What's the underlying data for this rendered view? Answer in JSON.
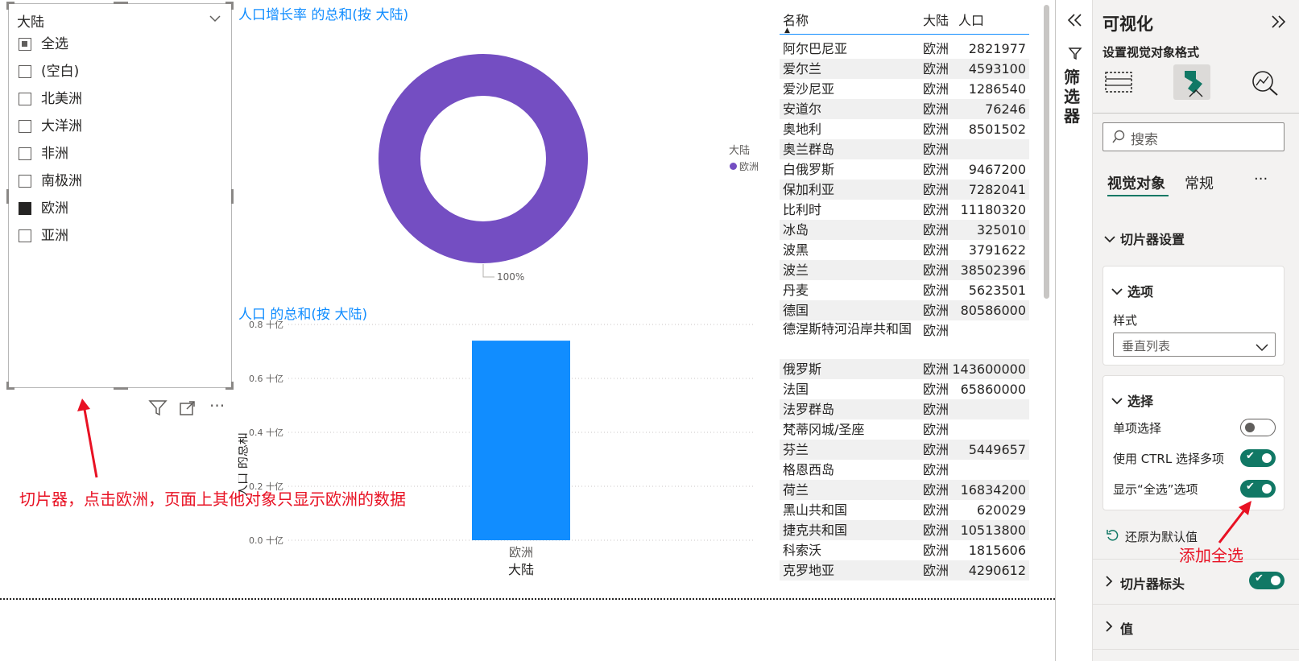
{
  "slicer": {
    "title": "大陆",
    "items": [
      {
        "label": "全选",
        "state": "partial"
      },
      {
        "label": "(空白)",
        "state": "unchecked"
      },
      {
        "label": "北美洲",
        "state": "unchecked"
      },
      {
        "label": "大洋洲",
        "state": "unchecked"
      },
      {
        "label": "非洲",
        "state": "unchecked"
      },
      {
        "label": "南极洲",
        "state": "unchecked"
      },
      {
        "label": "欧洲",
        "state": "checked"
      },
      {
        "label": "亚洲",
        "state": "unchecked"
      }
    ]
  },
  "donut": {
    "title": "人口增长率 的总和(按 大陆)",
    "color": "#744ec2",
    "slice_label": "100%",
    "legend_title": "大陆",
    "legend_items": [
      "欧洲"
    ]
  },
  "bar": {
    "title": "人口 的总和(按 大陆)"
  },
  "chart_data": [
    {
      "type": "pie",
      "title": "人口增长率 的总和(按 大陆)",
      "categories": [
        "欧洲"
      ],
      "values": [
        100
      ],
      "unit": "%",
      "legend_title": "大陆",
      "legend_position": "right"
    },
    {
      "type": "bar",
      "title": "人口 的总和(按 大陆)",
      "categories": [
        "欧洲"
      ],
      "values": [
        0.74
      ],
      "xlabel": "大陆",
      "ylabel": "人口 的总和",
      "yticks": [
        "0.0 十亿",
        "0.2 十亿",
        "0.4 十亿",
        "0.6 十亿",
        "0.8 十亿"
      ],
      "ylim": [
        0,
        0.8
      ],
      "color": "#118dff",
      "grid": true
    }
  ],
  "table": {
    "headers": [
      "名称",
      "大陆",
      "人口"
    ],
    "rows": [
      [
        "阿尔巴尼亚",
        "欧洲",
        "2821977"
      ],
      [
        "爱尔兰",
        "欧洲",
        "4593100"
      ],
      [
        "爱沙尼亚",
        "欧洲",
        "1286540"
      ],
      [
        "安道尔",
        "欧洲",
        "76246"
      ],
      [
        "奥地利",
        "欧洲",
        "8501502"
      ],
      [
        "奥兰群岛",
        "欧洲",
        ""
      ],
      [
        "白俄罗斯",
        "欧洲",
        "9467200"
      ],
      [
        "保加利亚",
        "欧洲",
        "7282041"
      ],
      [
        "比利时",
        "欧洲",
        "11180320"
      ],
      [
        "冰岛",
        "欧洲",
        "325010"
      ],
      [
        "波黑",
        "欧洲",
        "3791622"
      ],
      [
        "波兰",
        "欧洲",
        "38502396"
      ],
      [
        "丹麦",
        "欧洲",
        "5623501"
      ],
      [
        "德国",
        "欧洲",
        "80586000"
      ],
      [
        "德涅斯特河沿岸共和国",
        "欧洲",
        ""
      ],
      [
        "俄罗斯",
        "欧洲",
        "143600000"
      ],
      [
        "法国",
        "欧洲",
        "65860000"
      ],
      [
        "法罗群岛",
        "欧洲",
        ""
      ],
      [
        "梵蒂冈城/圣座",
        "欧洲",
        ""
      ],
      [
        "芬兰",
        "欧洲",
        "5449657"
      ],
      [
        "格恩西岛",
        "欧洲",
        ""
      ],
      [
        "荷兰",
        "欧洲",
        "16834200"
      ],
      [
        "黑山共和国",
        "欧洲",
        "620029"
      ],
      [
        "捷克共和国",
        "欧洲",
        "10513800"
      ],
      [
        "科索沃",
        "欧洲",
        "1815606"
      ],
      [
        "克罗地亚",
        "欧洲",
        "4290612"
      ]
    ]
  },
  "filters_label": "筛选器",
  "viz_pane": {
    "title": "可视化",
    "subtitle": "设置视觉对象格式",
    "search_placeholder": "搜索",
    "tabs": [
      "视觉对象",
      "常规"
    ],
    "more": "···",
    "section_slicer_settings": "切片器设置",
    "options_card": {
      "header": "选项",
      "style_label": "样式",
      "style_value": "垂直列表"
    },
    "selection_card": {
      "header": "选择",
      "toggles": [
        {
          "label": "单项选择",
          "on": false
        },
        {
          "label": "使用 CTRL 选择多项",
          "on": true
        },
        {
          "label": "显示“全选”选项",
          "on": true
        }
      ]
    },
    "reset_label": "还原为默认值",
    "section_slicer_header": "切片器标头",
    "slicer_header_on": true,
    "section_values": "值"
  },
  "annotations": {
    "left": "切片器，点击欧洲，页面上其他对象只显示欧洲的数据",
    "right": "添加全选",
    "color": "#e81123"
  }
}
